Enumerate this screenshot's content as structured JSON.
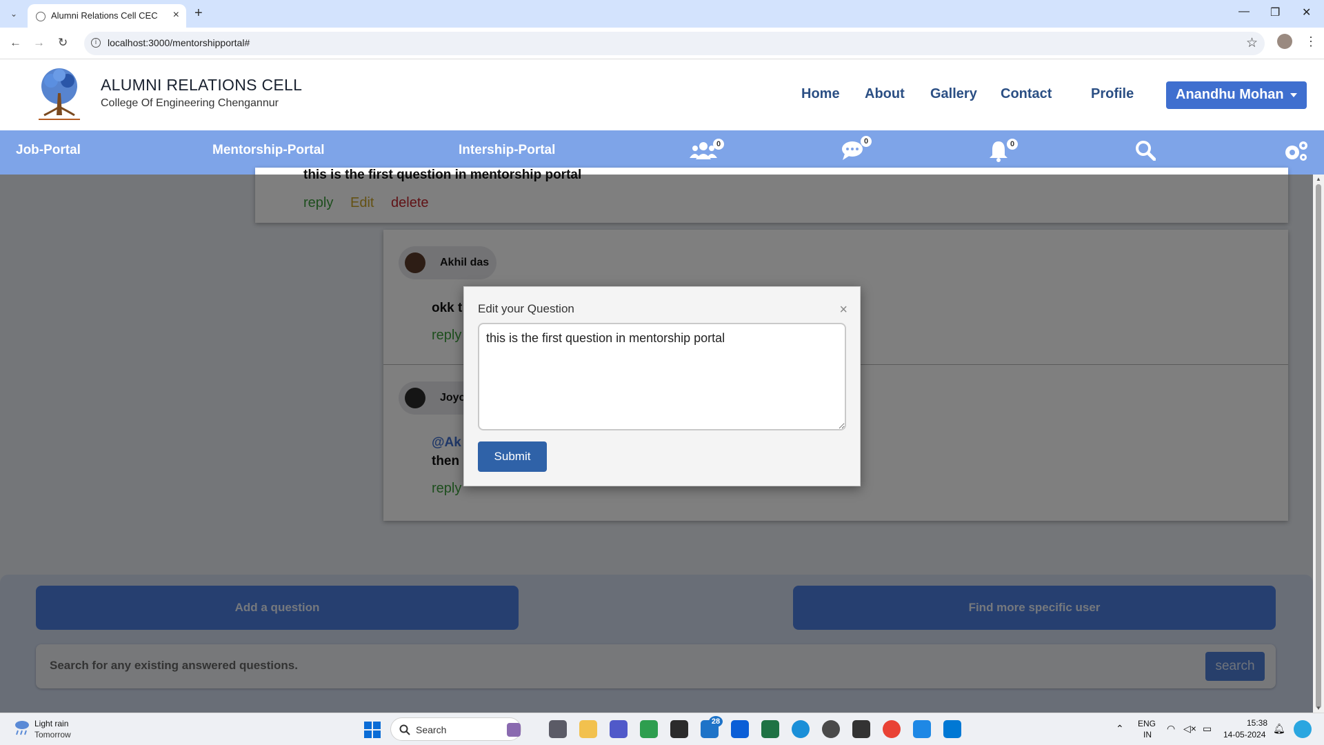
{
  "browser": {
    "tab_title": "Alumni Relations Cell CEC",
    "url": "localhost:3000/mentorshipportal#"
  },
  "header": {
    "title": "ALUMNI RELATIONS CELL",
    "subtitle": "College Of Engineering Chengannur",
    "nav": [
      "Home",
      "About",
      "Gallery",
      "Contact",
      "Profile"
    ],
    "user": "Anandhu Mohan"
  },
  "subnav": {
    "links": [
      "Job-Portal",
      "Mentorship-Portal",
      "Intership-Portal"
    ],
    "friends_count": "0",
    "messages_count": "0",
    "notifications_count": "0"
  },
  "question": {
    "text": "this is the first question in mentorship portal",
    "reply": "reply",
    "edit": "Edit",
    "delete": "delete"
  },
  "answers": [
    {
      "author": "Akhil das",
      "text": "okk t",
      "reply": "reply"
    },
    {
      "author": "Joyc",
      "mention": "@Ak",
      "text": "then",
      "reply": "reply"
    }
  ],
  "bottom": {
    "add_question": "Add a question",
    "find_user": "Find more specific user",
    "search_placeholder": "Search for any existing answered questions.",
    "search_button": "search"
  },
  "modal": {
    "title": "Edit your Question",
    "close": "×",
    "value": "this is the first question in mentorship portal",
    "submit": "Submit"
  },
  "taskbar": {
    "weather_line1": "Light rain",
    "weather_line2": "Tomorrow",
    "search_label": "Search",
    "mail_badge": "28",
    "lang1": "ENG",
    "lang2": "IN",
    "time": "15:38",
    "date": "14-05-2024"
  },
  "colors": {
    "subnav": "#7ea4e8",
    "user_button": "#3f6fcf",
    "reply": "#3a9d3a",
    "edit": "#c9a227",
    "delete": "#c0242d",
    "submit": "#2f62a8"
  }
}
